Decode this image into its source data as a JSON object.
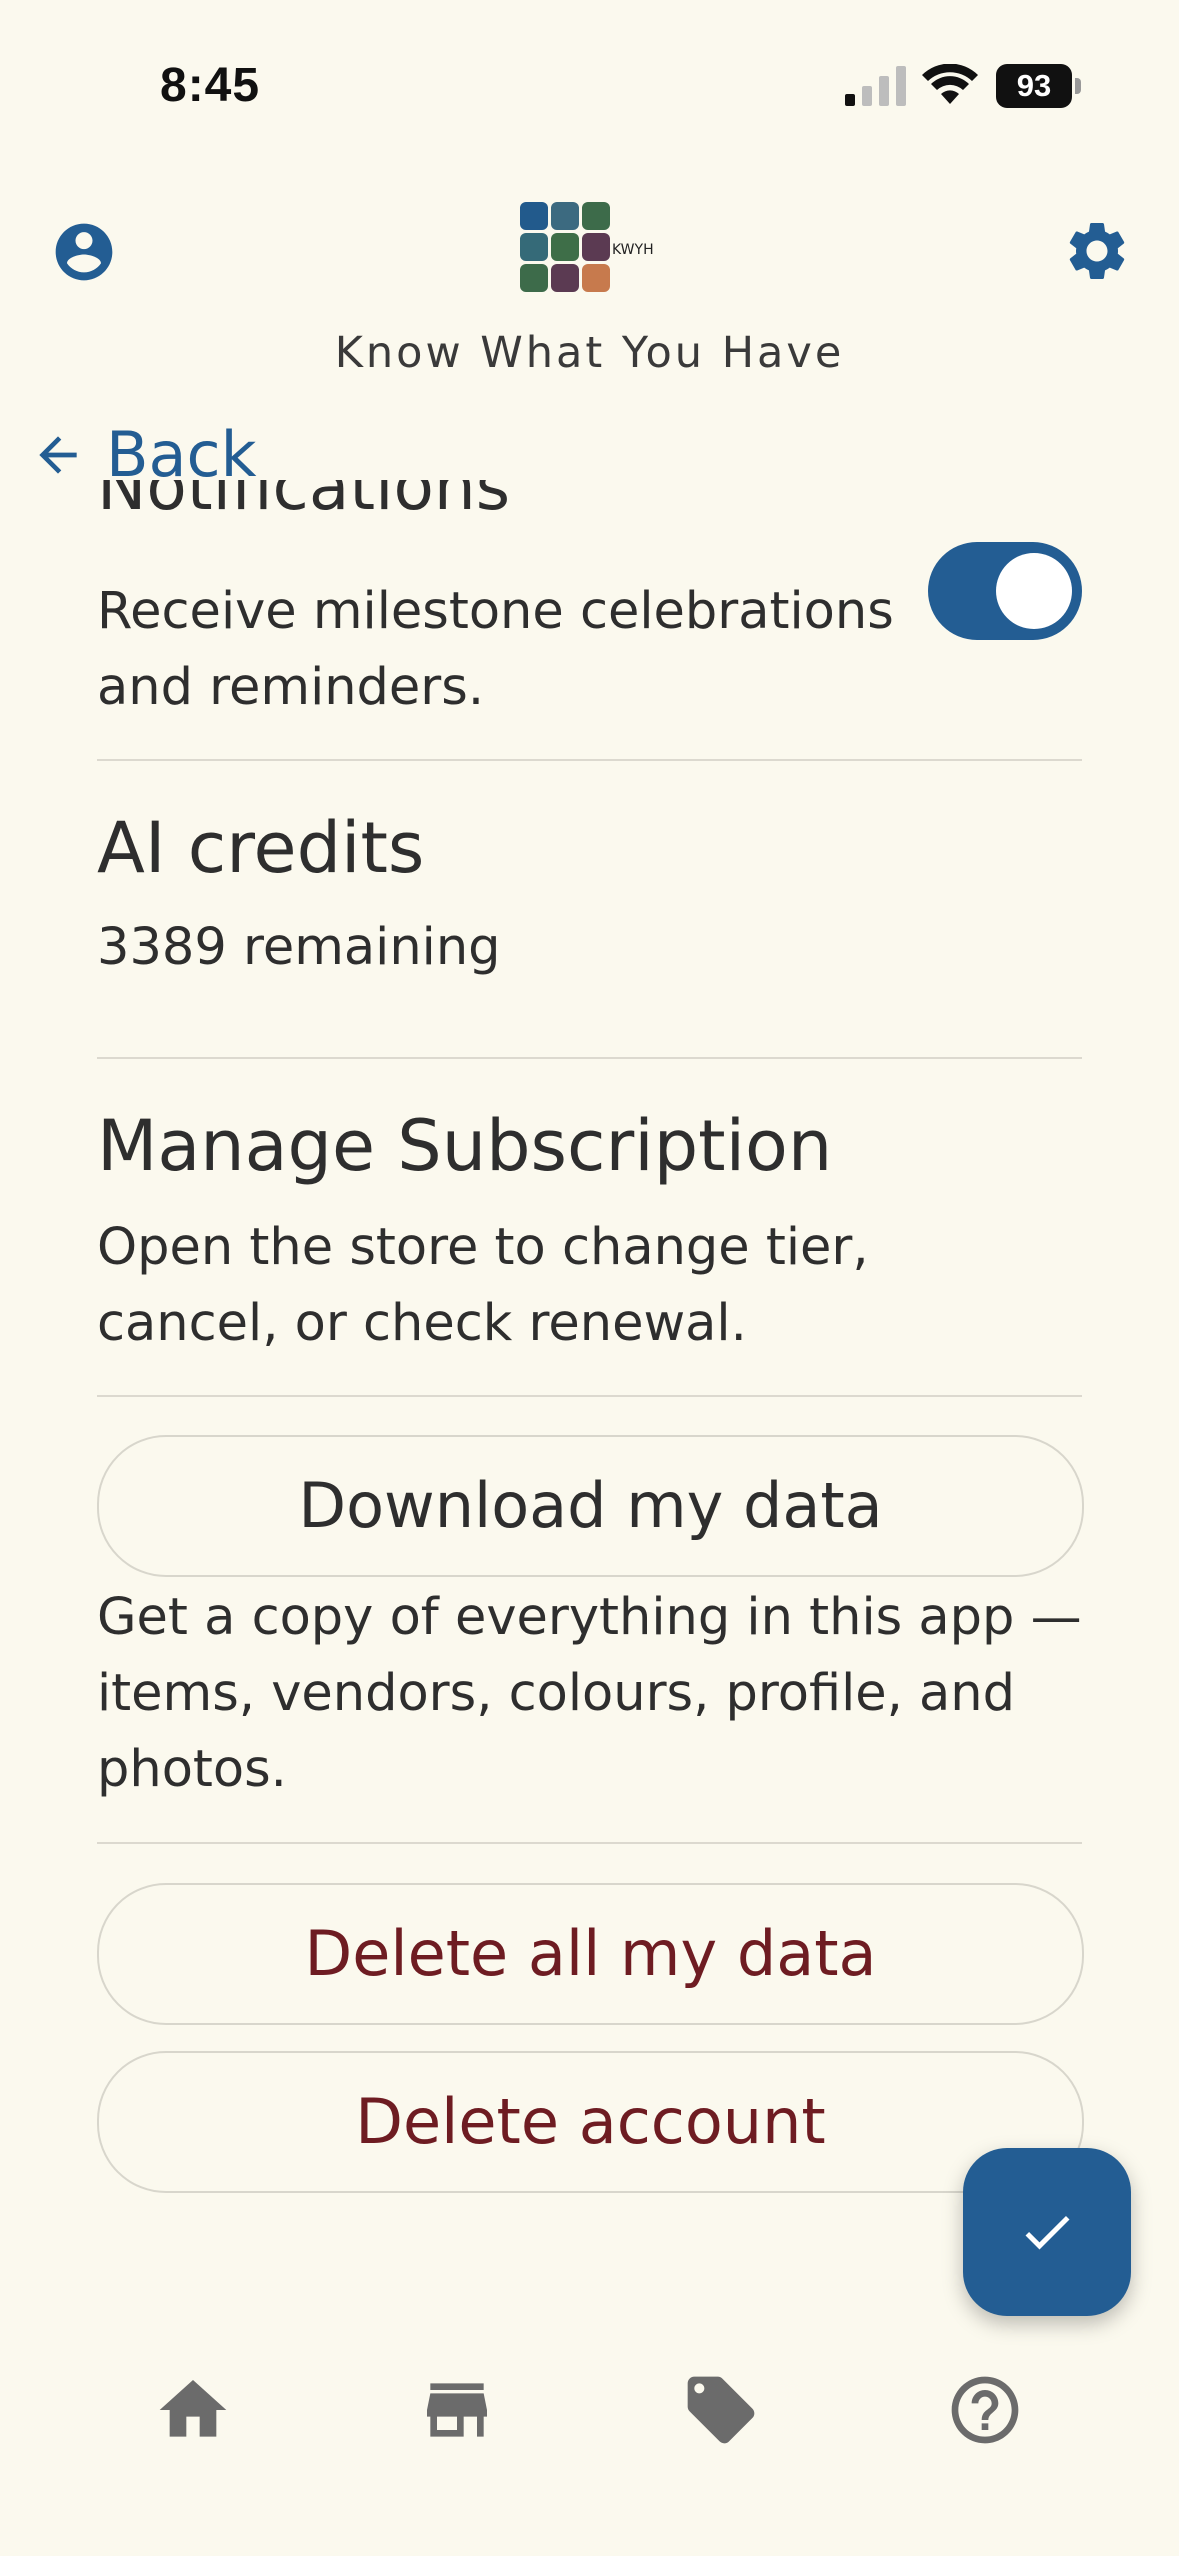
{
  "status_bar": {
    "time": "8:45",
    "battery": "93"
  },
  "header": {
    "app_title": "Know What You Have",
    "logo_text": "KWYH",
    "logo_colors": [
      "#225a8c",
      "#3c6a80",
      "#3d6b4a",
      "#356a78",
      "#3e6e48",
      "#5b3a52",
      "#3d6b4a",
      "#5b3a52",
      "#c77a4d"
    ],
    "profile_icon": "account-circle-icon",
    "settings_icon": "gear-icon"
  },
  "back": {
    "label": "Back"
  },
  "settings": {
    "notifications": {
      "title": "Notifications",
      "description": "Receive milestone celebrations and reminders.",
      "enabled": true
    },
    "ai_credits": {
      "title": "AI credits",
      "value": "3389 remaining"
    },
    "subscription": {
      "title": "Manage Subscription",
      "description": "Open the store to change tier, cancel, or check renewal."
    },
    "download": {
      "button_label": "Download my data",
      "description": "Get a copy of everything in this app — items, vendors, colours, profile, and photos."
    },
    "delete_data": {
      "button_label": "Delete all my data"
    },
    "delete_account": {
      "button_label": "Delete account"
    }
  },
  "fab": {
    "icon": "check-icon"
  },
  "bottom_nav": {
    "items": [
      {
        "icon": "home-icon"
      },
      {
        "icon": "store-icon"
      },
      {
        "icon": "tag-icon"
      },
      {
        "icon": "help-circle-icon"
      }
    ]
  },
  "colors": {
    "accent": "#235d93",
    "danger": "#6e1c22",
    "background": "#fbf9ee"
  }
}
